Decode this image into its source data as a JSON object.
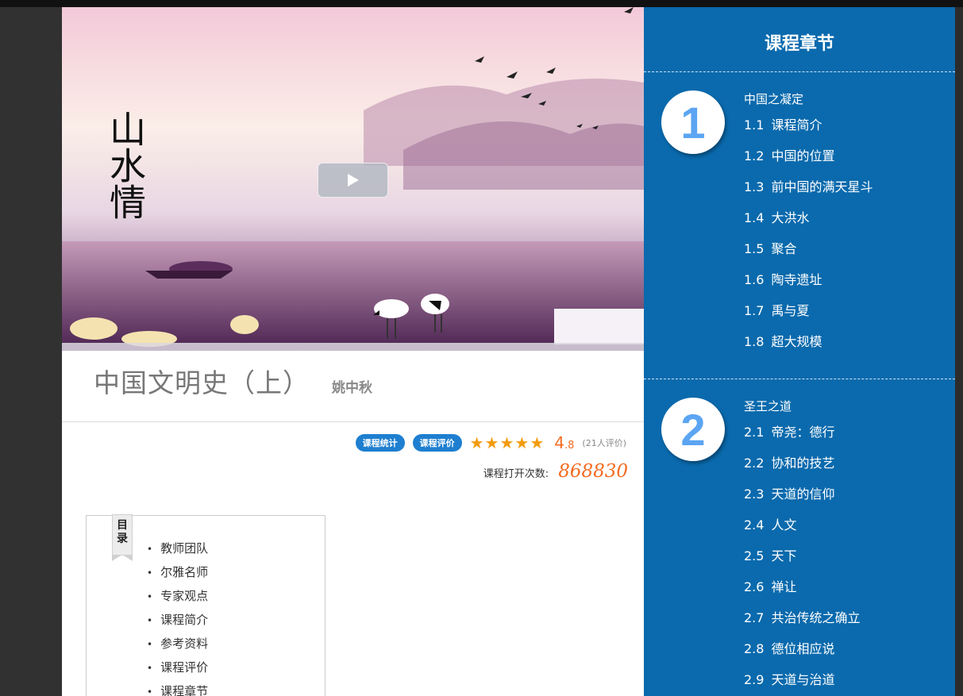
{
  "course": {
    "title": "中国文明史（上）",
    "teacher": "姚中秋",
    "stats_button": "课程统计",
    "review_button": "课程评价",
    "rating": "4",
    "rating_decimal": ".8",
    "rating_value": 4.8,
    "rating_count": "(21人评价)",
    "open_count_label": "课程打开次数:",
    "open_count": "868830"
  },
  "video": {
    "image_text_large": "山水情",
    "play_icon": "play-icon"
  },
  "toc": {
    "ribbon": "目录",
    "items": [
      "教师团队",
      "尔雅名师",
      "专家观点",
      "课程简介",
      "参考资料",
      "课程评价",
      "课程章节"
    ]
  },
  "chapters": {
    "heading": "课程章节",
    "list": [
      {
        "number": "1",
        "name": "中国之凝定",
        "lessons": [
          {
            "num": "1.1",
            "title": "课程简介"
          },
          {
            "num": "1.2",
            "title": "中国的位置"
          },
          {
            "num": "1.3",
            "title": "前中国的满天星斗"
          },
          {
            "num": "1.4",
            "title": "大洪水"
          },
          {
            "num": "1.5",
            "title": "聚合"
          },
          {
            "num": "1.6",
            "title": "陶寺遗址"
          },
          {
            "num": "1.7",
            "title": "禹与夏"
          },
          {
            "num": "1.8",
            "title": "超大规模"
          }
        ]
      },
      {
        "number": "2",
        "name": "圣王之道",
        "lessons": [
          {
            "num": "2.1",
            "title": "帝尧：德行"
          },
          {
            "num": "2.2",
            "title": "协和的技艺"
          },
          {
            "num": "2.3",
            "title": "天道的信仰"
          },
          {
            "num": "2.4",
            "title": "人文"
          },
          {
            "num": "2.5",
            "title": "天下"
          },
          {
            "num": "2.6",
            "title": "禅让"
          },
          {
            "num": "2.7",
            "title": "共治传统之确立"
          },
          {
            "num": "2.8",
            "title": "德位相应说"
          },
          {
            "num": "2.9",
            "title": "天道与治道"
          }
        ]
      }
    ]
  },
  "colors": {
    "accent_blue": "#0a6aad",
    "pill_blue": "#1e7fd0",
    "rating_orange": "#f36b21",
    "star": "#f29b0c",
    "circle_number": "#5ba5f2"
  }
}
